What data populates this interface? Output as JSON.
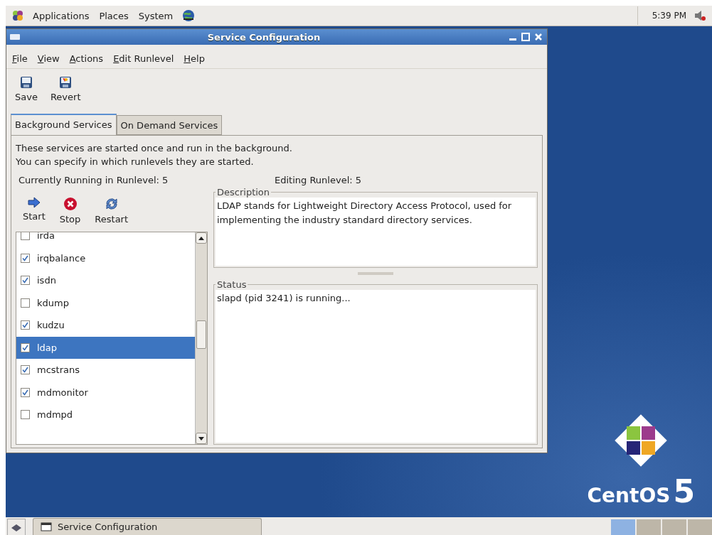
{
  "top_panel": {
    "menus": [
      "Applications",
      "Places",
      "System"
    ],
    "clock": "5:39 PM"
  },
  "window": {
    "title": "Service Configuration",
    "menu": [
      "File",
      "View",
      "Actions",
      "Edit Runlevel",
      "Help"
    ],
    "toolbar": [
      {
        "label": "Save",
        "kind": "save"
      },
      {
        "label": "Revert",
        "kind": "revert"
      }
    ],
    "tabs": [
      {
        "label": "Background Services",
        "selected": true
      },
      {
        "label": "On Demand Services",
        "selected": false
      }
    ],
    "intro": [
      "These services are started once and run in the background.",
      "You can specify in which runlevels they are started."
    ],
    "current_runlevel": "Currently Running in Runlevel: 5",
    "editing_runlevel": "Editing Runlevel: 5",
    "service_actions": [
      {
        "label": "Start",
        "kind": "start"
      },
      {
        "label": "Stop",
        "kind": "stop"
      },
      {
        "label": "Restart",
        "kind": "restart"
      }
    ],
    "services": [
      {
        "name": "irda",
        "checked": false,
        "selected": false
      },
      {
        "name": "irqbalance",
        "checked": true,
        "selected": false
      },
      {
        "name": "isdn",
        "checked": true,
        "selected": false
      },
      {
        "name": "kdump",
        "checked": false,
        "selected": false
      },
      {
        "name": "kudzu",
        "checked": true,
        "selected": false
      },
      {
        "name": "ldap",
        "checked": true,
        "selected": true
      },
      {
        "name": "mcstrans",
        "checked": true,
        "selected": false
      },
      {
        "name": "mdmonitor",
        "checked": true,
        "selected": false
      },
      {
        "name": "mdmpd",
        "checked": false,
        "selected": false
      }
    ],
    "description": {
      "title": "Description",
      "text": "LDAP stands for Lightweight Directory Access Protocol, used for implementing the industry standard directory services."
    },
    "status": {
      "title": "Status",
      "text": "slapd (pid 3241) is running..."
    }
  },
  "desktop": {
    "logo_text": "CentOS",
    "logo_version": "5"
  },
  "taskbar": {
    "tasks": [
      "Service Configuration"
    ]
  }
}
